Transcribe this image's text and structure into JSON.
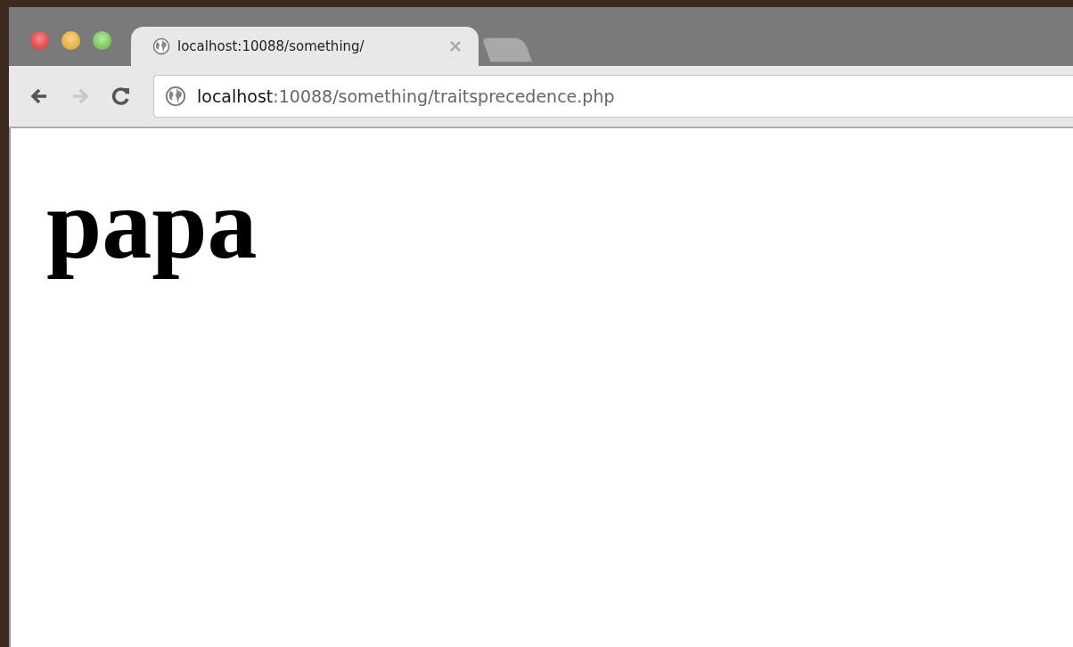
{
  "tabs": [
    {
      "title": "localhost:10088/something/",
      "selected": true
    }
  ],
  "toolbar": {
    "back": {
      "disabled": false
    },
    "forward": {
      "disabled": true
    },
    "reload": {
      "disabled": false
    }
  },
  "address": {
    "host": "localhost",
    "rest": ":10088/something/traitsprecedence.php"
  },
  "page": {
    "heading": "papa"
  }
}
